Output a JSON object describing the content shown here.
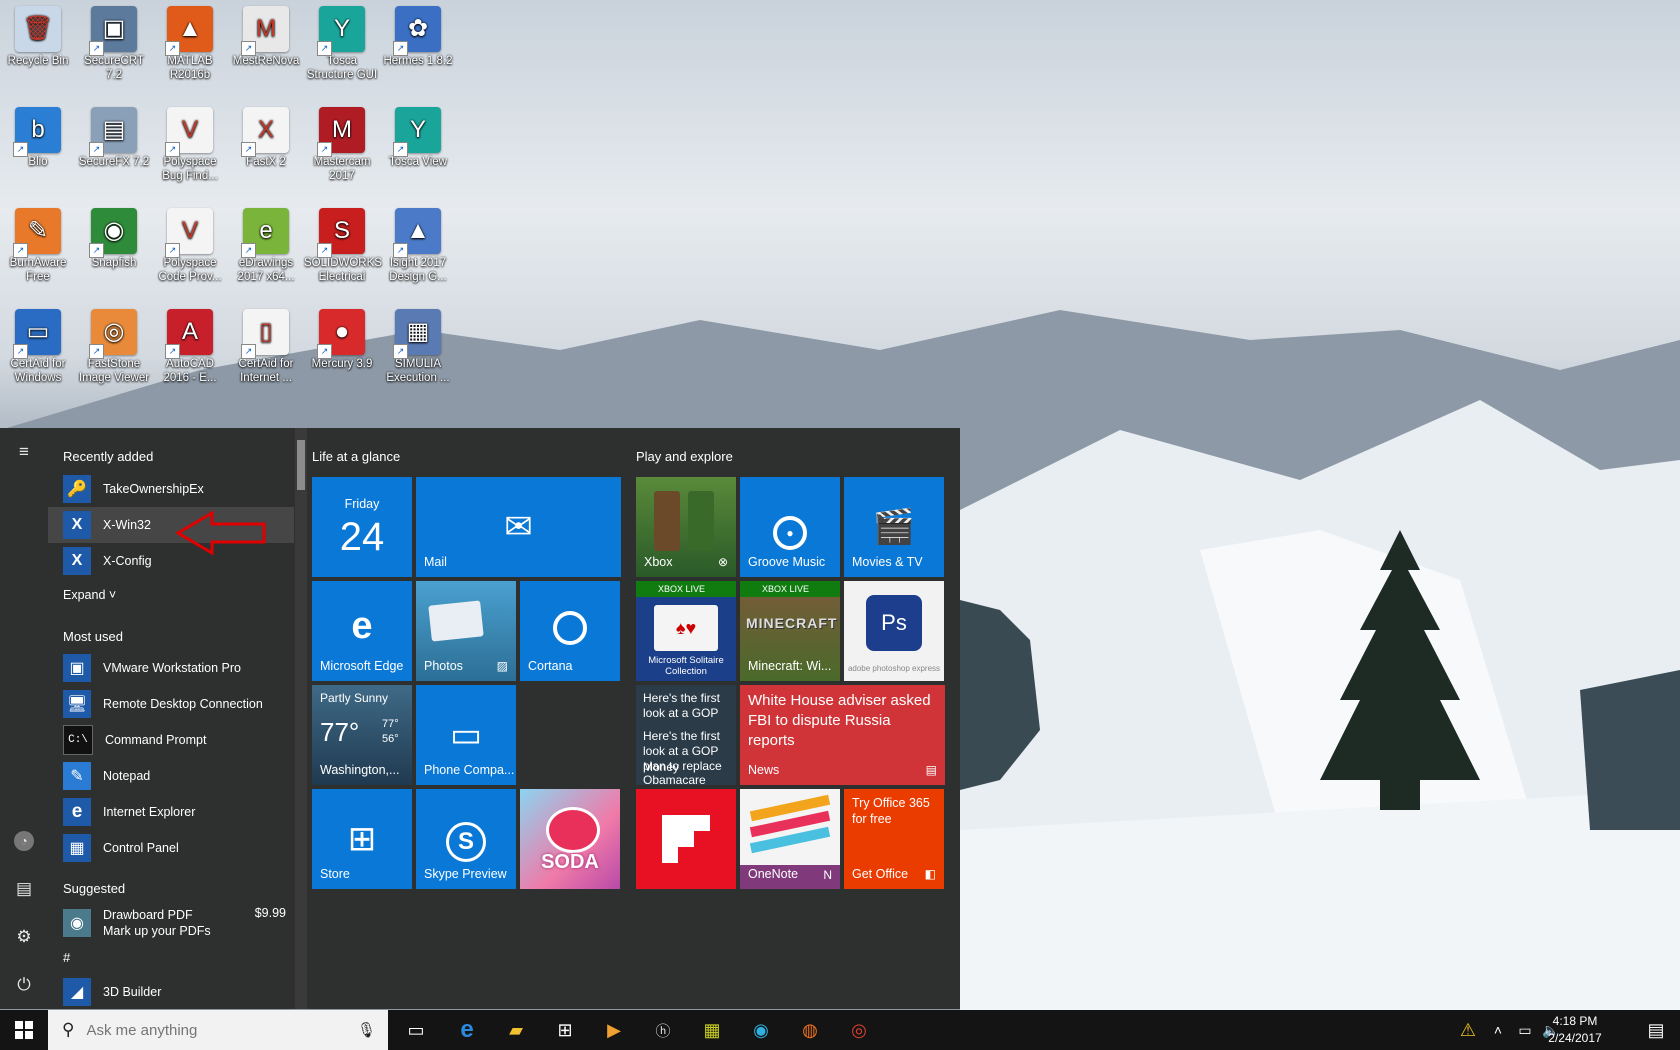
{
  "desktop": {
    "icons": [
      {
        "label": "Recycle Bin",
        "icon": "recycle-bin-icon",
        "color": "#c8d8e8"
      },
      {
        "label": "SecureCRT 7.2",
        "icon": "securecrt-icon",
        "color": "#5c7a9c"
      },
      {
        "label": "MATLAB R2016b",
        "icon": "matlab-icon",
        "color": "#e05a1a"
      },
      {
        "label": "MestReNova",
        "icon": "mestrenova-icon",
        "color": "#e8e8e8"
      },
      {
        "label": "Tosca Structure GUI",
        "icon": "tosca-icon",
        "color": "#1aa59a"
      },
      {
        "label": "Hermes 1.8.2",
        "icon": "hermes-icon",
        "color": "#3a6fc4"
      },
      {
        "label": "Blio",
        "icon": "blio-icon",
        "color": "#2a7fd4"
      },
      {
        "label": "SecureFX 7.2",
        "icon": "securefx-icon",
        "color": "#8aa0b8"
      },
      {
        "label": "Polyspace Bug Find...",
        "icon": "polyspace-icon",
        "color": "#f4f4f4"
      },
      {
        "label": "FastX 2",
        "icon": "fastx-icon",
        "color": "#f4f4f4"
      },
      {
        "label": "Mastercam 2017",
        "icon": "mastercam-icon",
        "color": "#b01c24"
      },
      {
        "label": "Tosca View",
        "icon": "tosca-view-icon",
        "color": "#1aa59a"
      },
      {
        "label": "BurnAware Free",
        "icon": "burnaware-icon",
        "color": "#e8792a"
      },
      {
        "label": "Snapfish",
        "icon": "snapfish-icon",
        "color": "#2e8b3a"
      },
      {
        "label": "Polyspace Code Prov...",
        "icon": "polyspace-code-icon",
        "color": "#f4f4f4"
      },
      {
        "label": "eDrawings 2017 x64...",
        "icon": "edrawings-icon",
        "color": "#7ab43a"
      },
      {
        "label": "SOLIDWORKS Electrical",
        "icon": "solidworks-icon",
        "color": "#c81e1e"
      },
      {
        "label": "Isight 2017 Design G...",
        "icon": "isight-icon",
        "color": "#4a7ac8"
      },
      {
        "label": "CertAid for Windows",
        "icon": "certaid-icon",
        "color": "#2a6cc4"
      },
      {
        "label": "FastStone Image Viewer",
        "icon": "faststone-icon",
        "color": "#e88a3a"
      },
      {
        "label": "AutoCAD 2016 - E...",
        "icon": "autocad-icon",
        "color": "#c8202a"
      },
      {
        "label": "CertAid for Internet ...",
        "icon": "certaid-internet-icon",
        "color": "#f4f4f4"
      },
      {
        "label": "Mercury 3.9",
        "icon": "mercury-icon",
        "color": "#d82a2a"
      },
      {
        "label": "SIMULIA Execution ...",
        "icon": "simulia-icon",
        "color": "#5a7ab4"
      }
    ]
  },
  "start_menu": {
    "recently_added_label": "Recently added",
    "recent": [
      {
        "label": "TakeOwnershipEx",
        "icon": "key-icon"
      },
      {
        "label": "X-Win32",
        "icon": "xwin32-icon"
      },
      {
        "label": "X-Config",
        "icon": "xconfig-icon"
      }
    ],
    "expand_label": "Expand",
    "most_used_label": "Most used",
    "most_used": [
      {
        "label": "VMware Workstation Pro",
        "icon": "vmware-icon"
      },
      {
        "label": "Remote Desktop Connection",
        "icon": "remote-desktop-icon"
      },
      {
        "label": "Command Prompt",
        "icon": "cmd-icon"
      },
      {
        "label": "Notepad",
        "icon": "notepad-icon"
      },
      {
        "label": "Internet Explorer",
        "icon": "ie-icon"
      },
      {
        "label": "Control Panel",
        "icon": "control-panel-icon"
      }
    ],
    "suggested_label": "Suggested",
    "suggested": {
      "title": "Drawboard PDF",
      "subtitle": "Mark up your PDFs",
      "price": "$9.99"
    },
    "hash_label": "#",
    "builder": {
      "label": "3D Builder"
    }
  },
  "tiles": {
    "group1_label": "Life at a glance",
    "group2_label": "Play and explore",
    "calendar": {
      "day": "Friday",
      "date": "24"
    },
    "mail": "Mail",
    "edge": "Microsoft Edge",
    "photos": "Photos",
    "cortana": "Cortana",
    "weather": {
      "condition": "Partly Sunny",
      "temp": "77°",
      "high": "77°",
      "low": "56°",
      "city": "Washington,..."
    },
    "phone": "Phone Compa...",
    "store": "Store",
    "skype": "Skype Preview",
    "candy": "SODA",
    "xbox": "Xbox",
    "groove": "Groove Music",
    "movies": "Movies & TV",
    "xbox_live": "XBOX LIVE",
    "solitaire": "Microsoft Solitaire Collection",
    "minecraft_logo": "MINECRAFT",
    "minecraft": "Minecraft: Wi...",
    "photoshop": "adobe photoshop express",
    "money_lines": [
      "Here's the first look at a GOP",
      "Here's the first look at a GOP plan to replace",
      "Money",
      "Obamacare"
    ],
    "news_headline": "White House adviser asked FBI to dispute Russia reports",
    "news_label": "News",
    "onenote": "OneNote",
    "office_promo": "Try Office 365 for free",
    "office": "Get Office"
  },
  "taskbar": {
    "search_placeholder": "Ask me anything",
    "time": "4:18 PM",
    "date": "2/24/2017"
  }
}
